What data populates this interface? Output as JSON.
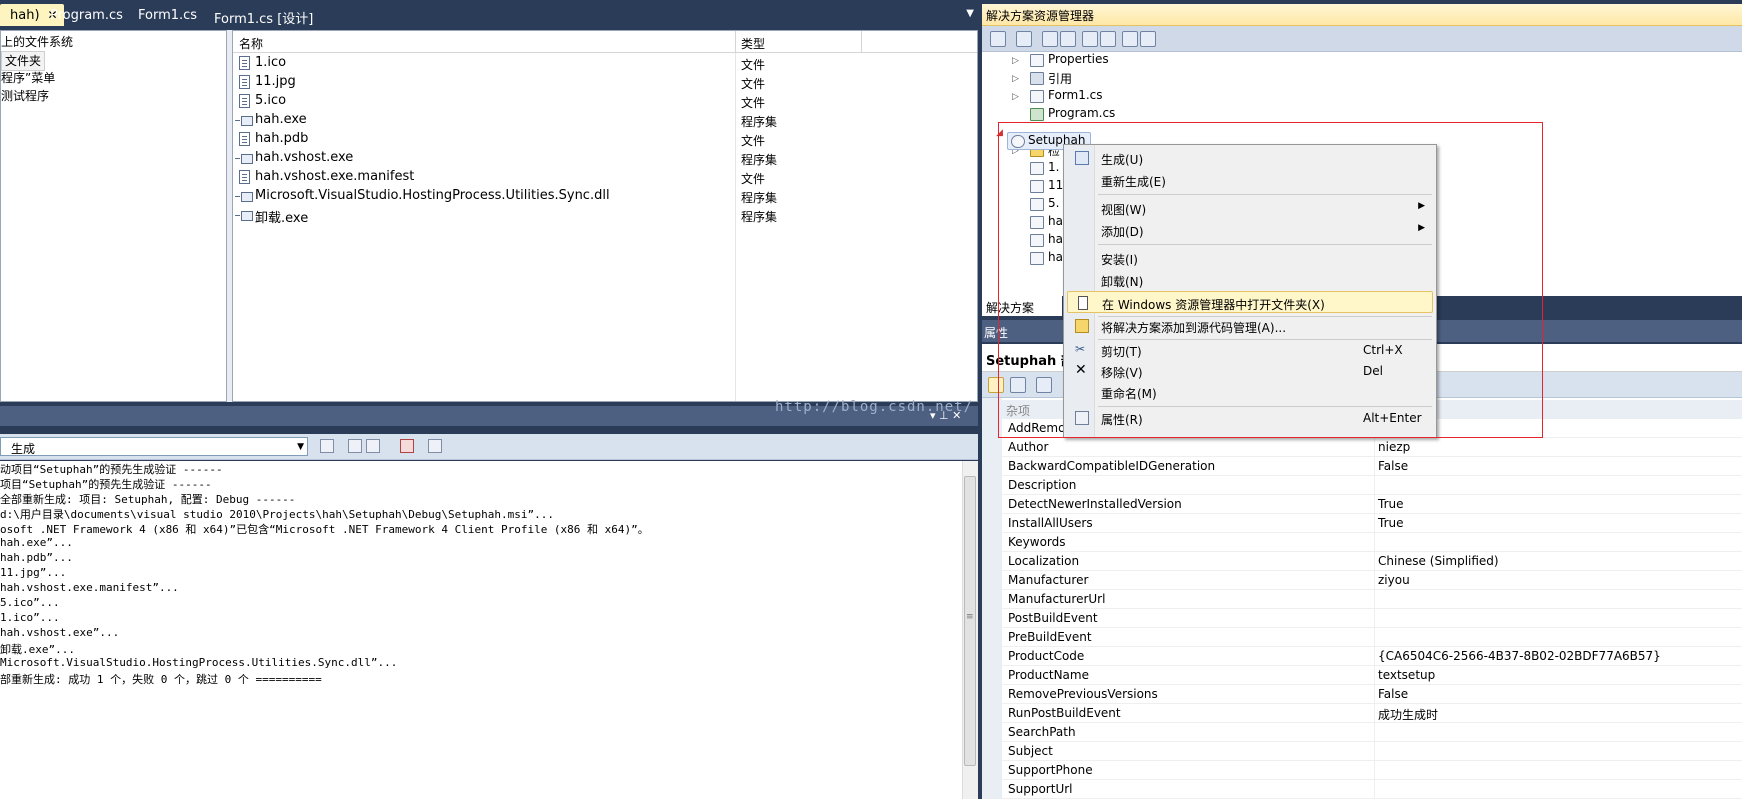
{
  "doc_tabs": [
    {
      "label": "hah)",
      "active": true
    },
    {
      "label": "Program.cs",
      "active": false
    },
    {
      "label": "Form1.cs",
      "active": false
    },
    {
      "label": "Form1.cs [设计]",
      "active": false
    }
  ],
  "fs_tree": [
    "上的文件系统",
    "文件夹",
    "程序”菜单",
    "测试程序"
  ],
  "fs_list": {
    "columns": [
      "名称",
      "类型"
    ],
    "rows": [
      {
        "name": "1.ico",
        "type": "文件",
        "icon": "file-icon"
      },
      {
        "name": "11.jpg",
        "type": "文件",
        "icon": "file-icon"
      },
      {
        "name": "5.ico",
        "type": "文件",
        "icon": "file-icon"
      },
      {
        "name": "hah.exe",
        "type": "程序集",
        "icon": "assembly-icon"
      },
      {
        "name": "hah.pdb",
        "type": "文件",
        "icon": "file-icon"
      },
      {
        "name": "hah.vshost.exe",
        "type": "程序集",
        "icon": "assembly-icon"
      },
      {
        "name": "hah.vshost.exe.manifest",
        "type": "文件",
        "icon": "file-icon"
      },
      {
        "name": "Microsoft.VisualStudio.HostingProcess.Utilities.Sync.dll",
        "type": "程序集",
        "icon": "assembly-icon"
      },
      {
        "name": "卸载.exe",
        "type": "程序集",
        "icon": "assembly-icon"
      }
    ]
  },
  "output": {
    "watermark": "http://blog.csdn.net/",
    "source_selected": "生成",
    "lines": [
      "动项目“Setuphah”的预先生成验证 ------",
      "项目“Setuphah”的预先生成验证 ------",
      "全部重新生成: 项目: Setuphah, 配置: Debug ------",
      "d:\\用户目录\\documents\\visual studio 2010\\Projects\\hah\\Setuphah\\Debug\\Setuphah.msi”...",
      "osoft .NET Framework 4 (x86 和 x64)”已包含“Microsoft .NET Framework 4 Client Profile (x86 和 x64)”。",
      "hah.exe”...",
      "hah.pdb”...",
      "11.jpg”...",
      "hah.vshost.exe.manifest”...",
      "5.ico”...",
      "1.ico”...",
      "hah.vshost.exe”...",
      "卸载.exe”...",
      "Microsoft.VisualStudio.HostingProcess.Utilities.Sync.dll”...",
      "部重新生成: 成功 1 个，失败 0 个，跳过 0 个 =========="
    ]
  },
  "solution_explorer": {
    "title": "解决方案资源管理器",
    "nodes": [
      "Properties",
      "引用",
      "Form1.cs",
      "Program.cs",
      "Setuphah",
      "检",
      "1.",
      "11",
      "5.",
      "ha",
      "ha",
      "ha"
    ],
    "bottom_tab": "解决方案"
  },
  "properties": {
    "title": "属性",
    "object_name": "Setuphah 部",
    "category": "杂项",
    "rows": [
      {
        "name": "AddRemo",
        "value": ""
      },
      {
        "name": "Author",
        "value": "niezp"
      },
      {
        "name": "BackwardCompatibleIDGeneration",
        "value": "False"
      },
      {
        "name": "Description",
        "value": ""
      },
      {
        "name": "DetectNewerInstalledVersion",
        "value": "True"
      },
      {
        "name": "InstallAllUsers",
        "value": "True"
      },
      {
        "name": "Keywords",
        "value": ""
      },
      {
        "name": "Localization",
        "value": "Chinese (Simplified)"
      },
      {
        "name": "Manufacturer",
        "value": "ziyou"
      },
      {
        "name": "ManufacturerUrl",
        "value": ""
      },
      {
        "name": "PostBuildEvent",
        "value": ""
      },
      {
        "name": "PreBuildEvent",
        "value": ""
      },
      {
        "name": "ProductCode",
        "value": "{CA6504C6-2566-4B37-8B02-02BDF77A6B57}"
      },
      {
        "name": "ProductName",
        "value": "textsetup"
      },
      {
        "name": "RemovePreviousVersions",
        "value": "False"
      },
      {
        "name": "RunPostBuildEvent",
        "value": "成功生成时"
      },
      {
        "name": "SearchPath",
        "value": ""
      },
      {
        "name": "Subject",
        "value": ""
      },
      {
        "name": "SupportPhone",
        "value": ""
      },
      {
        "name": "SupportUrl",
        "value": ""
      }
    ]
  },
  "context_menu": {
    "items": [
      {
        "label": "生成(U)",
        "accel": "",
        "submenu": false
      },
      {
        "label": "重新生成(E)",
        "accel": "",
        "submenu": false
      },
      {
        "label": "视图(W)",
        "accel": "",
        "submenu": true
      },
      {
        "label": "添加(D)",
        "accel": "",
        "submenu": true
      },
      {
        "label": "安装(I)",
        "accel": "",
        "submenu": false
      },
      {
        "label": "卸载(N)",
        "accel": "",
        "submenu": false
      },
      {
        "label": "在 Windows 资源管理器中打开文件夹(X)",
        "accel": "",
        "submenu": false,
        "highlighted": true
      },
      {
        "label": "将解决方案添加到源代码管理(A)...",
        "accel": "",
        "submenu": false
      },
      {
        "label": "剪切(T)",
        "accel": "Ctrl+X",
        "submenu": false
      },
      {
        "label": "移除(V)",
        "accel": "Del",
        "submenu": false
      },
      {
        "label": "重命名(M)",
        "accel": "",
        "submenu": false
      },
      {
        "label": "属性(R)",
        "accel": "Alt+Enter",
        "submenu": false
      }
    ]
  },
  "colors": {
    "ide_background": "#2b3c59",
    "highlight": "#fff6c9",
    "annotation_box": "#e5252b"
  }
}
